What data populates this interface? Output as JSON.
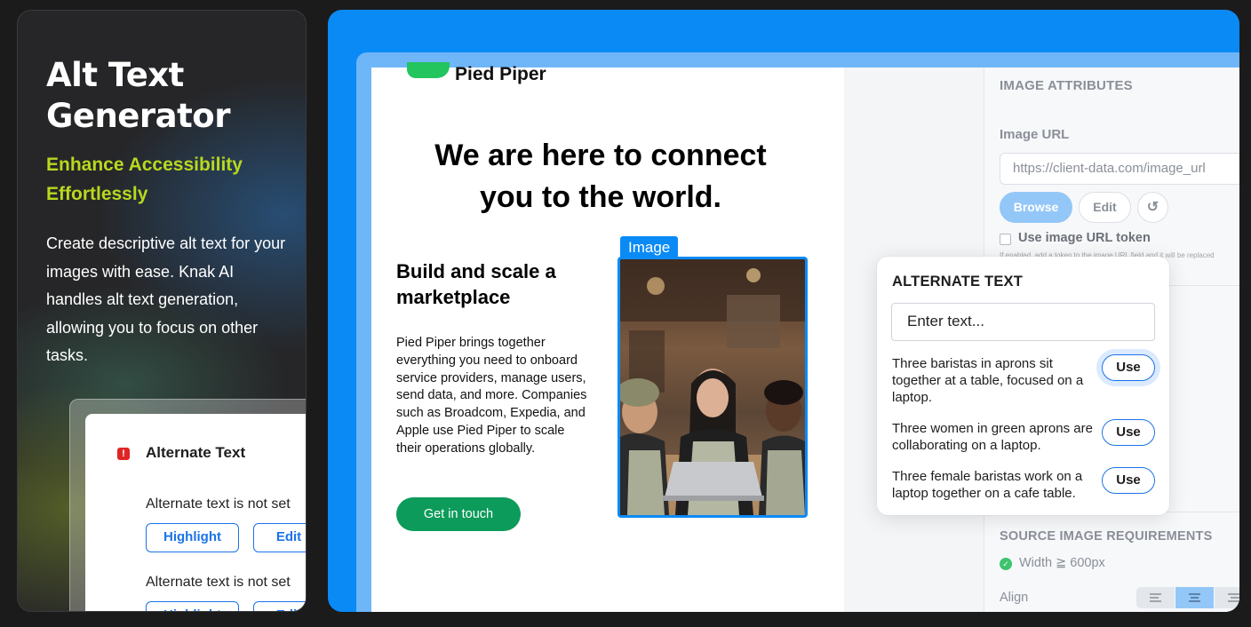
{
  "promo": {
    "title": "Alt Text Generator",
    "subtitle": "Enhance Accessibility Effortlessly",
    "description": "Create descriptive alt text for your images with ease. Knak AI handles alt text generation, allowing you to focus on other tasks.",
    "mini_panel": {
      "heading": "Alternate Text",
      "alert_icon": "!",
      "items": [
        {
          "message": "Alternate text is not set",
          "highlight_label": "Highlight",
          "edit_label": "Edit"
        },
        {
          "message": "Alternate text is not set",
          "highlight_label": "Highlight",
          "edit_label": "Edit"
        }
      ]
    }
  },
  "email": {
    "brand": "Pied Piper",
    "hero": "We are here to connect you to the world.",
    "section_title": "Build and scale a marketplace",
    "body": "Pied Piper brings together everything you need to onboard service providers, manage users, send data, and more. Companies such as Broadcom, Expedia, and Apple use Pied Piper to scale their operations globally.",
    "cta": "Get in touch",
    "image_tag": "Image"
  },
  "sidebar": {
    "section_title": "IMAGE ATTRIBUTES",
    "url_label": "Image URL",
    "url_value": "https://client-data.com/image_url",
    "browse_label": "Browse",
    "edit_label": "Edit",
    "token_label": "Use image URL token",
    "token_help": "If enabled, add a token to the image URL field and it will be replaced",
    "requirements_title": "SOURCE IMAGE REQUIREMENTS",
    "width_requirement": "Width  ≧ 600px",
    "align_label": "Align"
  },
  "alt_popover": {
    "title": "ALTERNATE TEXT",
    "placeholder": "Enter text...",
    "use_label": "Use",
    "suggestions": [
      "Three baristas in aprons sit together at a table, focused on a laptop.",
      "Three women in green aprons are collaborating on a laptop.",
      "Three female baristas work on a laptop together on a cafe table."
    ]
  },
  "colors": {
    "accent_blue": "#0a8af5",
    "brand_green": "#0c9b5a",
    "subtitle_lime": "#b8d81f",
    "alert_red": "#e02424"
  },
  "icons": [
    "alert-icon",
    "refresh-icon",
    "checkbox-icon",
    "check-circle-icon",
    "align-left-icon",
    "align-center-icon",
    "align-right-icon",
    "brand-logo-icon"
  ]
}
